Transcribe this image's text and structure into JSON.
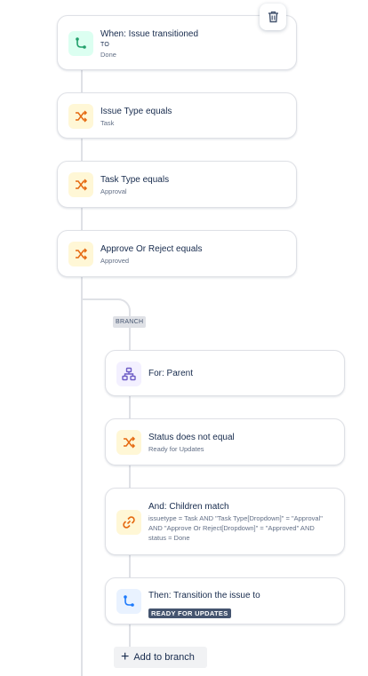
{
  "colors": {
    "trigger_icon": "#22a06b",
    "condition_icon": "#e56910",
    "branch_icon": "#6e5dc6",
    "action_icon": "#1d7afc",
    "rail": "#dfe1e6"
  },
  "trigger": {
    "title": "When: Issue transitioned",
    "to_label": "TO",
    "status": "Done",
    "icon": "transition-icon"
  },
  "conditions": [
    {
      "title": "Issue Type equals",
      "value": "Task",
      "icon": "shuffle-icon"
    },
    {
      "title": "Task Type equals",
      "value": "Approval",
      "icon": "shuffle-icon"
    },
    {
      "title": "Approve Or Reject equals",
      "value": "Approved",
      "icon": "shuffle-icon"
    }
  ],
  "branch": {
    "tag": "BRANCH",
    "for_title": "For: Parent",
    "status_condition": {
      "title": "Status does not equal",
      "value": "Ready for Updates"
    },
    "children_match": {
      "title": "And: Children match",
      "jql": "issuetype = Task AND \"Task Type[Dropdown]\" = \"Approval\" AND \"Approve Or Reject[Dropdown]\" = \"Approved\" AND status = Done"
    },
    "action": {
      "title": "Then: Transition the issue to",
      "status": "READY FOR UPDATES"
    },
    "add_label": "Add to branch"
  },
  "trash_icon": "trash-icon"
}
